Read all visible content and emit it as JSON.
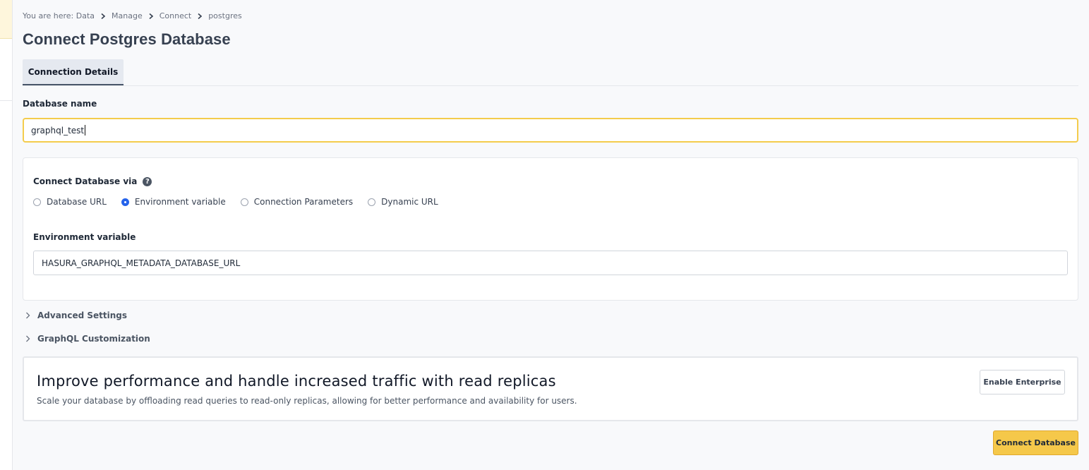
{
  "breadcrumb": {
    "prefix": "You are here:",
    "items": [
      "Data",
      "Manage",
      "Connect",
      "postgres"
    ]
  },
  "page_title": "Connect Postgres Database",
  "tabs": [
    {
      "label": "Connection Details",
      "active": true
    }
  ],
  "database_name": {
    "label": "Database name",
    "value": "graphql_test"
  },
  "connect_via": {
    "label": "Connect Database via",
    "help_icon": "question-circle-icon",
    "options": [
      {
        "label": "Database URL",
        "checked": false
      },
      {
        "label": "Environment variable",
        "checked": true
      },
      {
        "label": "Connection Parameters",
        "checked": false
      },
      {
        "label": "Dynamic URL",
        "checked": false
      }
    ]
  },
  "environment_variable": {
    "label": "Environment variable",
    "value": "HASURA_GRAPHQL_METADATA_DATABASE_URL"
  },
  "sections": {
    "advanced": "Advanced Settings",
    "graphql": "GraphQL Customization"
  },
  "promo": {
    "title": "Improve performance and handle increased traffic with read replicas",
    "description": "Scale your database by offloading read queries to read-only replicas, allowing for better performance and availability for users.",
    "button": "Enable Enterprise"
  },
  "connect_button": "Connect Database",
  "colors": {
    "accent_yellow": "#f5c84a",
    "focus_border": "#f4cc4c",
    "radio_checked": "#2563eb"
  }
}
